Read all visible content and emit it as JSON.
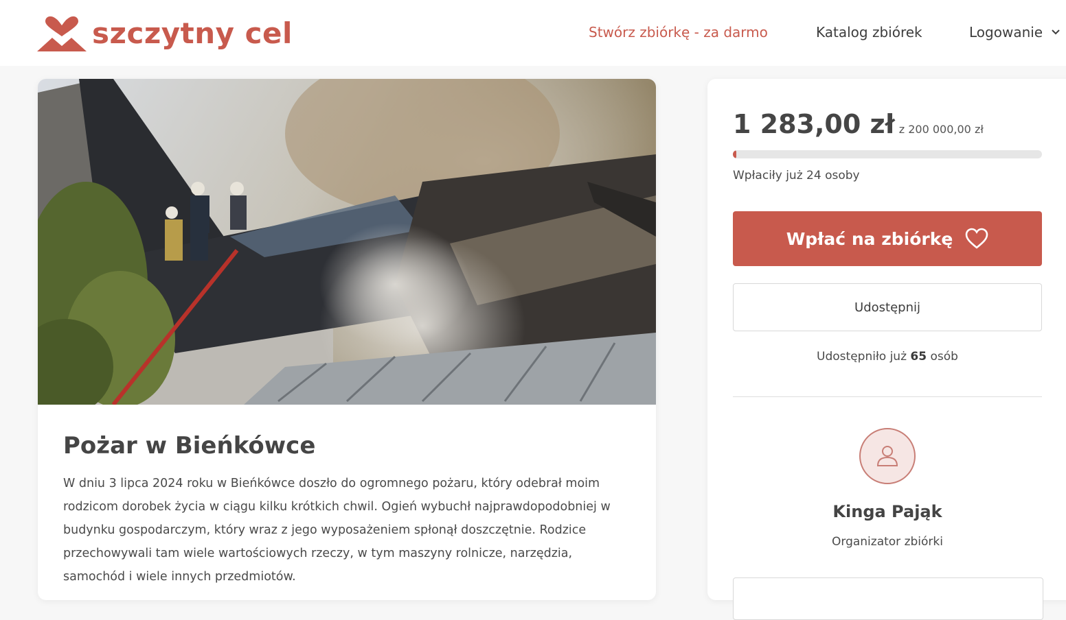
{
  "brand": {
    "name": "szczytny cel",
    "color": "#c85a4d"
  },
  "nav": {
    "create": "Stwórz zbiórkę - za darmo",
    "catalog": "Katalog zbiórek",
    "login": "Logowanie"
  },
  "campaign": {
    "image_alt": "Pożar domu, strażacy na dachu",
    "title": "Pożar w Bieńkówce",
    "description": "W dniu 3 lipca 2024 roku w Bieńkówce doszło do ogromnego pożaru, który odebrał moim rodzicom dorobek życia w ciągu kilku krótkich chwil. Ogień wybuchł najprawdopodobniej w budynku gospodarczym, który wraz z jego wyposażeniem spłonął doszczętnie. Rodzice przechowywali tam wiele wartościowych rzeczy, w tym maszyny rolnicze, narzędzia, samochód i wiele innych przedmiotów."
  },
  "funding": {
    "raised": "1 283,00 zł",
    "goal": "z 200 000,00 zł",
    "progress_fraction": 0.0064,
    "donors_text": "Wpłaciły już 24 osoby",
    "donate_label": "Wpłać na zbiórkę",
    "share_label": "Udostępnij",
    "shares_prefix": "Udostępniło już",
    "shares_count": "65",
    "shares_suffix": "osób"
  },
  "organizer": {
    "name": "Kinga Pająk",
    "role": "Organizator zbiórki"
  },
  "icons": [
    "heart-logo-icon",
    "chevron-down-icon",
    "heart-icon",
    "user-icon"
  ]
}
